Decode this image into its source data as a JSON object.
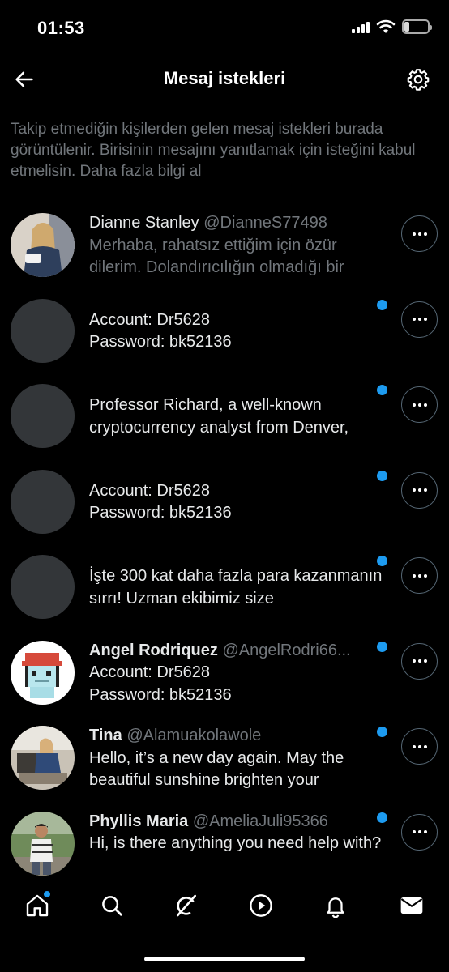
{
  "status_bar": {
    "time": "01:53",
    "battery": "21",
    "battery_fraction": 0.21
  },
  "header": {
    "title": "Mesaj istekleri",
    "back_icon": "arrow-left-icon",
    "settings_icon": "gear-icon"
  },
  "info": {
    "text": "Takip etmediğin kişilerden gelen mesaj istekleri burada görüntülenir. Birisinin mesajını yanıtlamak için isteğini kabul etmelisin. ",
    "link": "Daha fazla bilgi al"
  },
  "requests": [
    {
      "name": "Dianne Stanley",
      "handle": "@DianneS77498",
      "message": "Merhaba, rahatsız ettiğim için özür dilerim. Dolandırıcılığın olmadığı bir",
      "unread": false,
      "bold_name": false,
      "avatar": "photo-woman-blue-jacket"
    },
    {
      "name": "",
      "handle": "",
      "message": "Account: Dr5628\nPassword: bk52136",
      "unread": true,
      "bold_name": false,
      "avatar": "default"
    },
    {
      "name": "",
      "handle": "",
      "message": "Professor Richard, a well-known cryptocurrency analyst from Denver,",
      "unread": true,
      "bold_name": false,
      "avatar": "default"
    },
    {
      "name": "",
      "handle": "",
      "message": "Account: Dr5628\nPassword: bk52136",
      "unread": true,
      "bold_name": false,
      "avatar": "default"
    },
    {
      "name": "",
      "handle": "",
      "message": "İşte 300 kat daha fazla para kazanmanın sırrı! Uzman ekibimiz size",
      "unread": true,
      "bold_name": false,
      "avatar": "default"
    },
    {
      "name": "Angel Rodriquez",
      "handle": "@AngelRodri66...",
      "message": "Account: Dr5628\nPassword: bk52136",
      "unread": true,
      "bold_name": true,
      "avatar": "pixel-art-character"
    },
    {
      "name": "Tina",
      "handle": "@Alamuakolawole",
      "message": "Hello, it’s a new day again. May the beautiful sunshine brighten your",
      "unread": true,
      "bold_name": true,
      "avatar": "photo-woman-sitting"
    },
    {
      "name": "Phyllis Maria",
      "handle": "@AmeliaJuli95366",
      "message": "Hi, is there anything you need help with?",
      "unread": true,
      "bold_name": true,
      "avatar": "photo-man-outdoors"
    }
  ],
  "more_icon": "more-horizontal-icon",
  "tabbar": {
    "tabs": [
      {
        "icon": "home-icon",
        "has_dot": true
      },
      {
        "icon": "search-icon",
        "has_dot": false
      },
      {
        "icon": "grok-icon",
        "has_dot": false
      },
      {
        "icon": "play-icon",
        "has_dot": false
      },
      {
        "icon": "bell-icon",
        "has_dot": false
      },
      {
        "icon": "mail-icon",
        "has_dot": false
      }
    ]
  },
  "colors": {
    "background": "#000000",
    "accent": "#1d9bf0",
    "text_primary": "#e7e9ea",
    "text_secondary": "#71767b",
    "divider": "#2f3336"
  }
}
